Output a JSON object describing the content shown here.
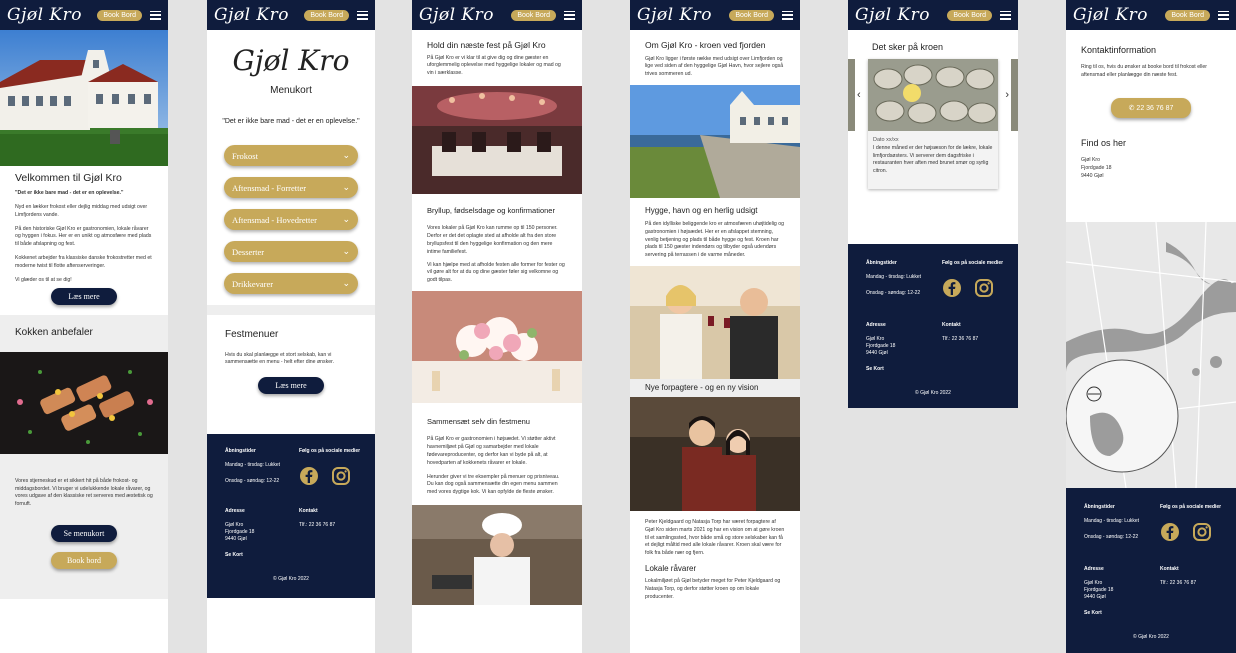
{
  "brand": {
    "logo": "Gjøl Kro",
    "book_label": "Book Bord",
    "colors": {
      "navy": "#0f1c3d",
      "gold": "#c7a95a"
    }
  },
  "s1": {
    "welcome_title": "Velkommen til Gjøl Kro",
    "tagline": "\"Det er ikke bare mad - det er en oplevelse.\"",
    "p1": "Nyd en lækker frokost eller dejlig middag med udsigt over Limfjordens vande.",
    "p2": "På den historiske Gjøl Kro er gastronomien, lokale råvarer og hyggen i fokus. Her er en unikt og atmosfære med plads til både afslapning og fest.",
    "p3": "Kokkenet arbejder fra klassiske danske frokostretter med et moderne twist til flotte aftenserveringer.",
    "p4": "Vi glæder os til at se dig!",
    "read_more": "Læs mere",
    "chef_title": "Kokken anbefaler",
    "p5": "Vores stjerneskud er et sikkert hit på både frokost- og middagsbordet. Vi bruger vi udelukkende lokale råvarer, og vores udgave af den klassiske ret serveres med æstetisk og fornuft.",
    "see_menu": "Se menukort",
    "book": "Book bord"
  },
  "s2": {
    "logo_big": "Gjøl Kro",
    "menu_title": "Menukort",
    "quote": "\"Det er ikke bare mad - det er en oplevelse.\"",
    "categories": [
      "Frokost",
      "Aftensmad - Forretter",
      "Aftensmad - Hovedretter",
      "Desserter",
      "Drikkevarer"
    ],
    "fest_title": "Festmenuer",
    "fest_text": "Hvis du skal planlægge et stort selskab, kan vi sammensætte en menu - helt efter dine ønsker.",
    "read_more": "Læs mere"
  },
  "s3": {
    "title1": "Hold din næste fest på Gjøl Kro",
    "text1": "På Gjøl Kro er vi klar til at give dig og dine gæster en uforglemmelig oplevelse med hyggelige lokaler og mad og vin i særklasse.",
    "title2": "Bryllup, fødselsdage og konfirmationer",
    "text2": "Vores lokaler på Gjøl Kro kan rumme op til 150 personer. Derfor er det det oplagte sted at afholde alt fra den store bryllupsfest til den hyggelige konfirmation og den mere intime familiefest.",
    "text3": "Vi kan hjælpe med at afholde festen alle former for fester og vil gøre alt for at du og dine gæster føler sig velkomne og godt tilpas.",
    "title3": "Sammensæt selv din festmenu",
    "text4": "På Gjøl Kro er gastronomien i højsædet. Vi støtter aktivt havnemiljøet på Gjøl og samarbejder med lokale fødevareproducenter, og derfor kan vi byde på alt, at hovedparten af kokkenets råvarer er lokale.",
    "text5": "Herunder giver vi tre eksempler på menuer og prisniveau. Du kan dog også sammensætte din egen menu sammen med vores dygtige kok. Vi kan opfylde de fleste ønsker."
  },
  "s4": {
    "title1": "Om Gjøl Kro - kroen ved fjorden",
    "text1": "Gjøl Kro ligger i første række med udsigt over Limfjorden og lige ved siden af den hyggelige Gjøl Havn, hvor sejlere også trives sommeren ud.",
    "title2": "Hygge, havn og en herlig udsigt",
    "text2": "På den idylliske beliggende kro er atmosfæren uhøjtidelig og gastronomien i højsædet. Her er en afslappet stemning, venlig betjening og plads til både hygge og fest. Kroen har plads til 150 gæster indendørs og tilbyder også udendørs servering på terrassen i de varme måneder.",
    "title3": "Nye forpagtere - og en ny vision",
    "text3": "Peter Kjeldgaard og Natasja Torp har været forpagtere af Gjøl Kro siden marts 2021 og har en vision om at gøre kroen til et samlingssted, hvor både små og store selskaber kan få et dejligt måltid med alle lokale råvarer. Kroen skal være for folk fra både nær og fjern.",
    "title4": "Lokale råvarer",
    "text4": "Lokalmiljøet på Gjøl betyder meget for Peter Kjeldgaard og Natasja Torp, og derfor støtter kroen op om lokale producenter."
  },
  "s5": {
    "title": "Det sker på kroen",
    "date": "Dato xx/xx",
    "text": "I denne måned er der højsæson for de lækre, lokale limfjordsøsters. Vi serverer dem dagsfriske i restauranten hver aften med brunet smør og syrlig citron."
  },
  "s6": {
    "contact_title": "Kontaktinformation",
    "contact_text": "Ring til os, hvis du ønsker at booke bord til frokost eller aftensmad eller planlægge din næste fest.",
    "phone_btn": "22 36 76 87",
    "find_title": "Find os her",
    "address": [
      "Gjøl Kro",
      "Fjordgade 18",
      "9440 Gjøl"
    ]
  },
  "footer": {
    "hours_title": "Åbningstider",
    "hours1": "Mandag - tirsdag: Lukket",
    "hours2": "Onsdag - søndag: 12-22",
    "social_title": "Følg os på sociale medier",
    "addr_title": "Adresse",
    "addr": [
      "Gjøl Kro",
      "Fjordgade 18",
      "9440 Gjøl"
    ],
    "map_link": "Se Kort",
    "contact_title": "Kontakt",
    "phone": "Tlf.: 22 36 76 87",
    "copyright": "© Gjøl Kro 2022"
  }
}
